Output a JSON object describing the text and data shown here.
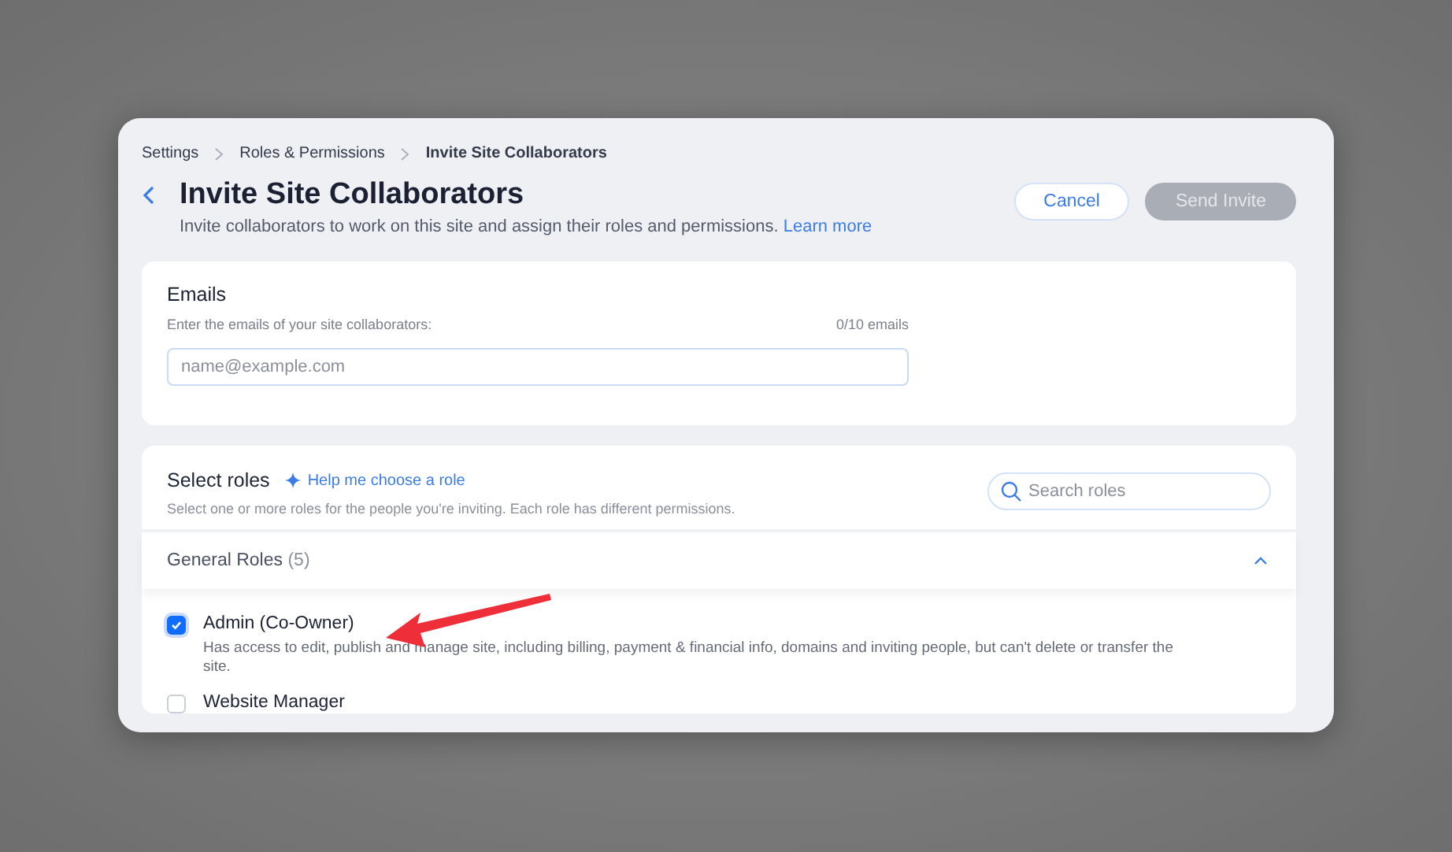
{
  "breadcrumbs": [
    "Settings",
    "Roles & Permissions",
    "Invite Site Collaborators"
  ],
  "header": {
    "title": "Invite Site Collaborators",
    "subtitle": "Invite collaborators to work on this site and assign their roles and permissions.",
    "link": "Learn more"
  },
  "buttons": {
    "cancel": "Cancel",
    "send": {
      "label": "Send Invite",
      "disabled": true
    }
  },
  "emails": {
    "title": "Emails",
    "hint": "Enter the emails of your site collaborators:",
    "count": "0/10 emails",
    "placeholder": "name@example.com"
  },
  "roles": {
    "title": "Select roles",
    "help": "Help me choose a role",
    "subtitle": "Select one or more roles for the people you're inviting. Each role has different permissions.",
    "search_placeholder": "Search roles",
    "group": {
      "name": "General Roles",
      "count": "(5)",
      "expanded": true
    },
    "items": [
      {
        "name": "Admin (Co-Owner)",
        "description": "Has access to edit, publish and manage site, including billing, payment & financial info, domains and inviting people, but can't delete or transfer the site.",
        "checked": true
      },
      {
        "name": "Website Manager",
        "checked": false
      }
    ]
  }
}
